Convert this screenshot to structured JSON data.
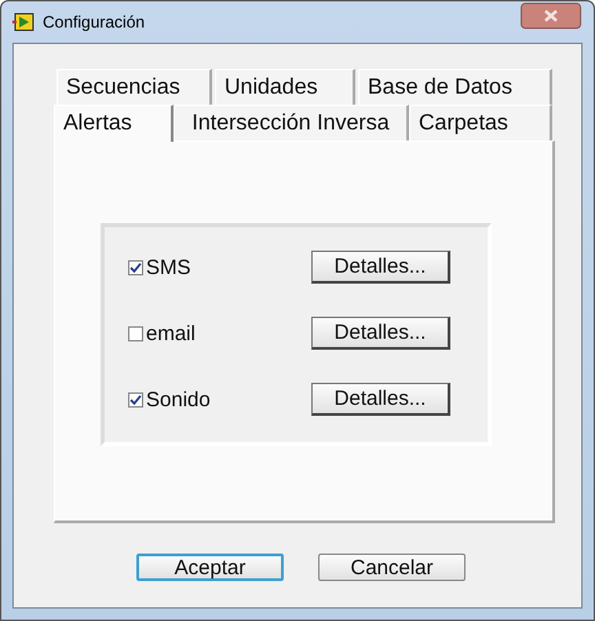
{
  "window": {
    "title": "Configuración"
  },
  "tab_rows": [
    [
      {
        "label": "Secuencias",
        "selected": false
      },
      {
        "label": "Unidades",
        "selected": false
      },
      {
        "label": "Base de Datos",
        "selected": false
      }
    ],
    [
      {
        "label": "Alertas",
        "selected": true
      },
      {
        "label": "Intersección Inversa",
        "selected": false
      },
      {
        "label": "Carpetas",
        "selected": false
      }
    ]
  ],
  "alerts": [
    {
      "label": "SMS",
      "checked": true,
      "button": "Detalles..."
    },
    {
      "label": "email",
      "checked": false,
      "button": "Detalles..."
    },
    {
      "label": "Sonido",
      "checked": true,
      "button": "Detalles..."
    }
  ],
  "buttons": [
    {
      "label": "Aceptar",
      "default": true
    },
    {
      "label": "Cancelar",
      "default": false
    }
  ]
}
